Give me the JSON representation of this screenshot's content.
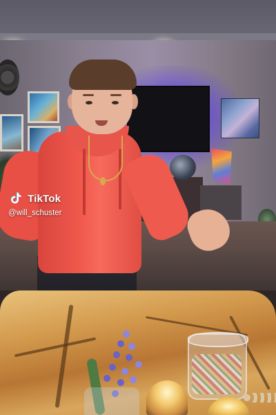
{
  "watermark": {
    "brand": "TikTok",
    "username": "@will_schuster",
    "icon": "tiktok-logo-icon"
  },
  "colors": {
    "accent_cyan": "#25F4EE",
    "accent_red": "#FE2C55",
    "text": "#FFFFFF"
  }
}
